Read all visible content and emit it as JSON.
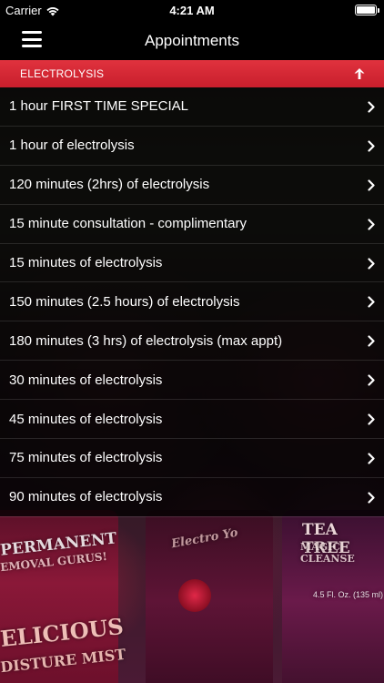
{
  "status_bar": {
    "carrier": "Carrier",
    "time": "4:21 AM"
  },
  "navbar": {
    "title": "Appointments",
    "menu_icon": "hamburger-menu-icon"
  },
  "section": {
    "title": "ELECTROLYSIS",
    "toggle_icon": "arrow-up-icon",
    "color": "#d62834"
  },
  "items": [
    {
      "label": "1 hour FIRST TIME SPECIAL"
    },
    {
      "label": "1 hour of electrolysis"
    },
    {
      "label": "120 minutes (2hrs) of electrolysis"
    },
    {
      "label": "15 minute consultation - complimentary"
    },
    {
      "label": "15 minutes of electrolysis"
    },
    {
      "label": "150 minutes (2.5 hours) of electrolysis"
    },
    {
      "label": "180 minutes (3 hrs) of electrolysis (max appt)"
    },
    {
      "label": "30 minutes of electrolysis"
    },
    {
      "label": "45 minutes of electrolysis"
    },
    {
      "label": "75 minutes of electrolysis"
    },
    {
      "label": "90 minutes of electrolysis"
    }
  ],
  "background_photo": {
    "label_1a": "PERMANENT",
    "label_1b": "EMOVAL GURUS!",
    "label_2a": "ELICIOUS",
    "label_2b": "DISTURE MIST",
    "label_3a": "TEA TREE",
    "label_3b": "MAGIC CLEANSE",
    "label_3c": "4.5 Fl. Oz. (135 ml)",
    "label_4": "Electro Yo"
  }
}
